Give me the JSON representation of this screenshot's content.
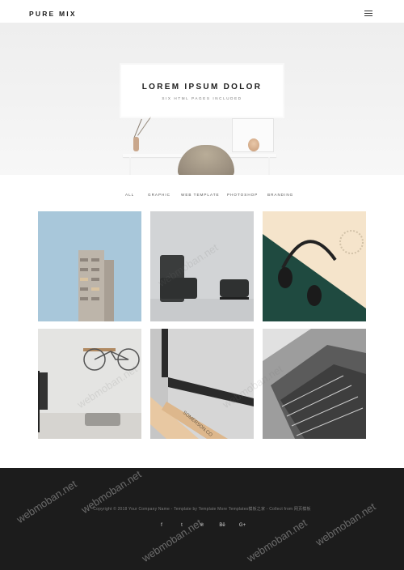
{
  "header": {
    "brand": "PURE MIX",
    "menu_icon": "hamburger-menu-icon"
  },
  "hero": {
    "title": "LOREM IPSUM DOLOR",
    "subtitle": "SIX HTML PAGES INCLUDED"
  },
  "filters": [
    "ALL",
    "GRAPHIC",
    "WEB TEMPLATE",
    "PHOTOSHOP",
    "BRANDING"
  ],
  "portfolio": [
    {
      "image": "building-photo"
    },
    {
      "image": "armchair-photo"
    },
    {
      "image": "headphones-photo"
    },
    {
      "image": "bicycle-room-photo"
    },
    {
      "image": "wooden-stool-photo"
    },
    {
      "image": "architecture-photo"
    }
  ],
  "footer": {
    "copyright": "Copyright © 2018 Your Company Name - Template by Template More Templates模板之家 - Collect from 网页模板",
    "social": [
      {
        "icon": "facebook-icon",
        "glyph": "f"
      },
      {
        "icon": "twitter-icon",
        "glyph": "t"
      },
      {
        "icon": "pinterest-icon",
        "glyph": "℗"
      },
      {
        "icon": "behance-icon",
        "glyph": "Bē"
      },
      {
        "icon": "google-plus-icon",
        "glyph": "G+"
      }
    ]
  },
  "watermark": "webmoban.net",
  "colors": {
    "footer_bg": "#1c1c1c",
    "hero_bg": "#efefef",
    "text": "#1b1b1b"
  }
}
